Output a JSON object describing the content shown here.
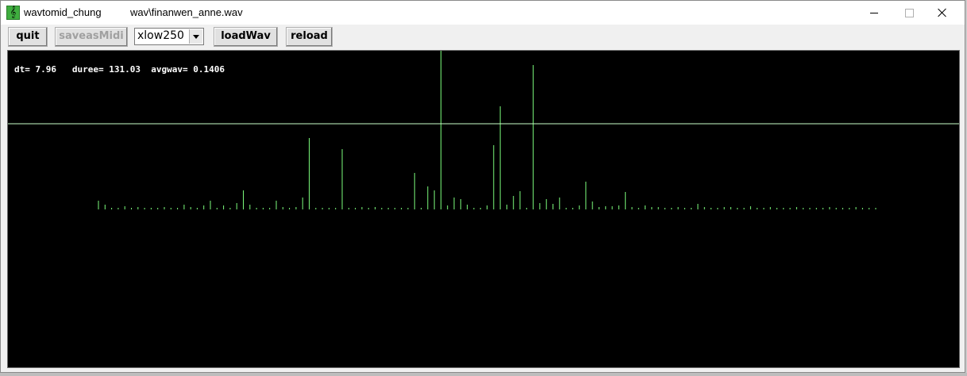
{
  "window": {
    "app_title": "wavtomid_chung",
    "file_title": "wav\\finanwen_anne.wav",
    "app_icon_glyph": "𝄞"
  },
  "toolbar": {
    "quit_label": "quit",
    "saveasmidi_label": "saveasMidi",
    "loadwav_label": "loadWav",
    "reload_label": "reload",
    "filter_select": {
      "value": "xlow250"
    }
  },
  "stats": {
    "dt_label": "dt=",
    "dt_value": "7.96",
    "duree_label": "duree=",
    "duree_value": "131.03",
    "avgwav_label": "avgwav=",
    "avgwav_value": "0.1406"
  },
  "colors": {
    "background": "#000000",
    "bars": "#7CFC7C",
    "threshold_line": "#C8FFC8",
    "stats_text": "#ffffff"
  },
  "chart_data": {
    "type": "bar",
    "ylim": [
      0,
      200
    ],
    "threshold": 108,
    "values": [
      11,
      6,
      2,
      2,
      4,
      2,
      3,
      2,
      2,
      2,
      3,
      2,
      2,
      6,
      3,
      2,
      5,
      11,
      2,
      5,
      2,
      8,
      24,
      6,
      2,
      2,
      2,
      11,
      3,
      2,
      3,
      15,
      90,
      2,
      2,
      2,
      2,
      76,
      2,
      2,
      3,
      2,
      3,
      2,
      2,
      2,
      2,
      2,
      46,
      2,
      29,
      24,
      200,
      5,
      15,
      13,
      6,
      2,
      2,
      5,
      81,
      130,
      6,
      17,
      23,
      2,
      182,
      8,
      13,
      7,
      15,
      2,
      2,
      5,
      35,
      10,
      3,
      4,
      4,
      5,
      22,
      3,
      2,
      5,
      3,
      3,
      2,
      2,
      3,
      2,
      2,
      7,
      3,
      2,
      2,
      3,
      3,
      2,
      2,
      4,
      2,
      2,
      3,
      2,
      2,
      2,
      3,
      2,
      2,
      2,
      2,
      3,
      2,
      2,
      2,
      3,
      2,
      2,
      2
    ]
  }
}
